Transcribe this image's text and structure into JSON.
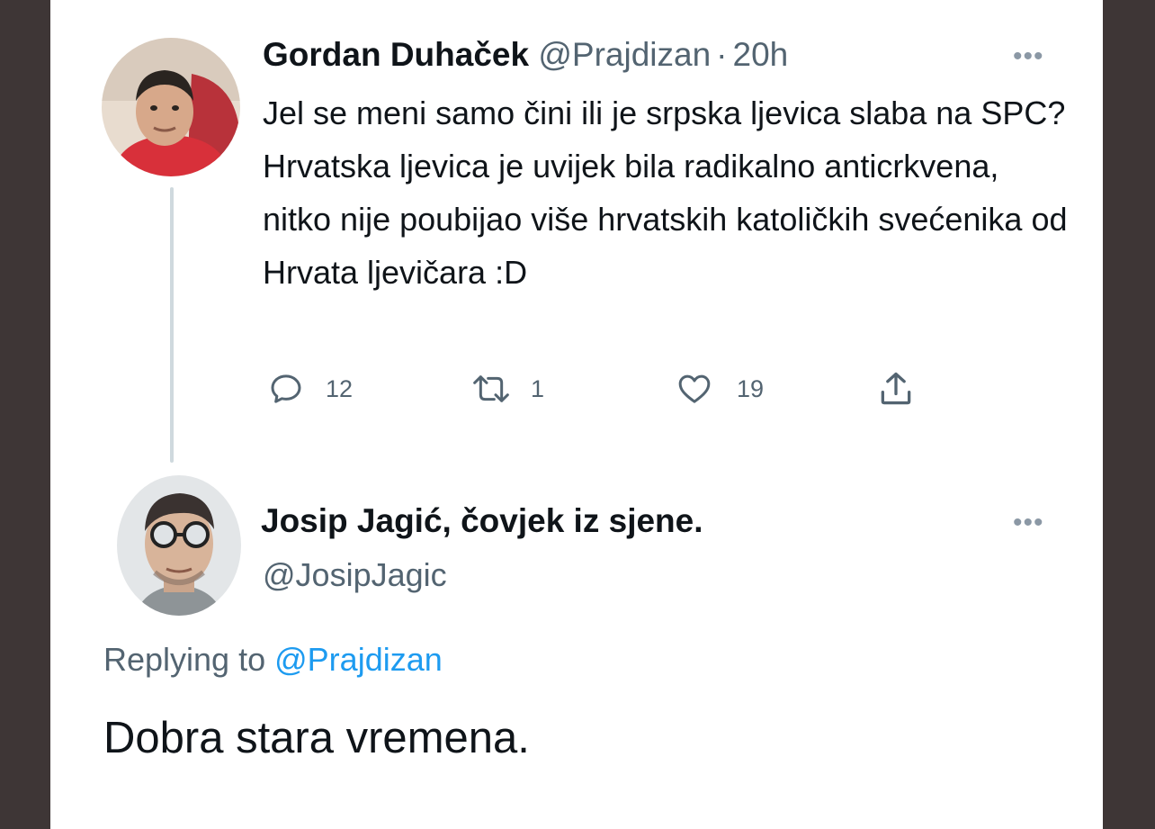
{
  "tweet": {
    "author_name": "Gordan Duhaček",
    "author_handle": "@Prajdizan",
    "separator": "·",
    "time": "20h",
    "more_label": "•••",
    "text": "Jel se meni samo čini ili je srpska ljevica slaba na SPC? Hrvatska ljevica je uvijek bila radikalno anticrkvena, nitko nije poubijao više hrvatskih katoličkih svećenika od Hrvata ljevičara :D",
    "reply_count": "12",
    "retweet_count": "1",
    "like_count": "19"
  },
  "reply": {
    "author_name": "Josip Jagić, čovjek iz sjene.",
    "author_handle": "@JosipJagic",
    "more_label": "•••",
    "replying_prefix": "Replying to",
    "replying_handle": "@Prajdizan",
    "text": "Dobra stara vremena."
  },
  "colors": {
    "background": "#3e3636",
    "card": "#ffffff",
    "text": "#0f1419",
    "muted": "#536471",
    "link": "#1d9bf0"
  },
  "icons": {
    "reply": "reply-icon",
    "retweet": "retweet-icon",
    "like": "heart-icon",
    "share": "share-icon",
    "more": "more-icon"
  }
}
